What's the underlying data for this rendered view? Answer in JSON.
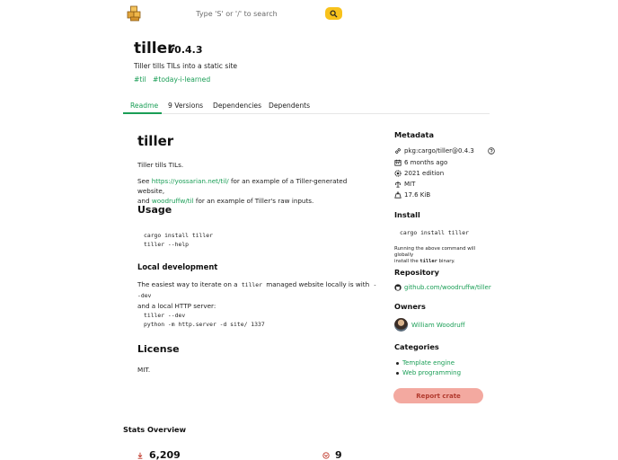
{
  "header": {
    "search_placeholder": "Type 'S' or '/' to search"
  },
  "crate": {
    "name": "tiller",
    "version": "v0.4.3",
    "description": "Tiller tills TILs into a static site",
    "keywords": [
      "#til",
      "#today-i-learned"
    ]
  },
  "tabs": [
    {
      "label": "Readme",
      "active": true
    },
    {
      "label": "9 Versions",
      "active": false
    },
    {
      "label": "Dependencies",
      "active": false
    },
    {
      "label": "Dependents",
      "active": false
    }
  ],
  "readme": {
    "title": "tiller",
    "intro": "Tiller tills TILs.",
    "see_prefix": "See ",
    "see_link1": "https://yossarian.net/til/",
    "see_mid": " for an example of a Tiller-generated website,",
    "see_and": "and ",
    "see_link2": "woodruffw/til",
    "see_suffix": " for an example of Tiller's raw inputs.",
    "usage_heading": "Usage",
    "usage_code": [
      "cargo install tiller",
      "tiller --help"
    ],
    "local_heading": "Local development",
    "local_p_a": "The easiest way to iterate on a ",
    "local_code1": "tiller",
    "local_p_b": " managed website locally is with ",
    "local_code2": "--dev",
    "local_p_c": "and a local HTTP server:",
    "local_code": [
      "tiller --dev",
      "python -m http.server -d site/ 1337"
    ],
    "license_heading": "License",
    "license_text": "MIT."
  },
  "sidebar": {
    "metadata_heading": "Metadata",
    "purl": "pkg:cargo/tiller@0.4.3",
    "age": "6 months ago",
    "edition": "2021 edition",
    "license": "MIT",
    "size": "17.6 KiB",
    "install_heading": "Install",
    "install_cmd": "cargo install tiller",
    "install_note_a": "Running the above command will globally",
    "install_note_b": "install the ",
    "install_note_bin": "tiller",
    "install_note_c": " binary.",
    "repository_heading": "Repository",
    "repository": "github.com/woodruffw/tiller",
    "owners_heading": "Owners",
    "owner": "William Woodruff",
    "categories_heading": "Categories",
    "categories": [
      "Template engine",
      "Web programming"
    ],
    "report_label": "Report crate"
  },
  "stats": {
    "heading": "Stats Overview",
    "downloads": "6,209",
    "versions": "9"
  },
  "colors": {
    "accent": "#1a9e56",
    "search_button": "#f8c21c",
    "report_button": "#f3a9a0"
  }
}
